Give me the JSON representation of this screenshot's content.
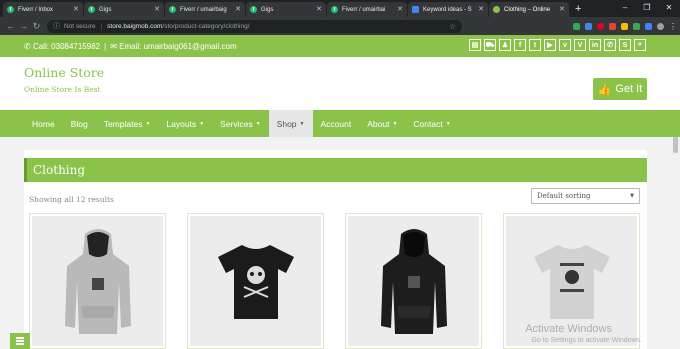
{
  "browser": {
    "tabs": [
      {
        "title": "Fiverr / Inbox",
        "icon": "fiverr-icon"
      },
      {
        "title": "Gigs",
        "icon": "fiverr-icon"
      },
      {
        "title": "Fiverr / umairbaig",
        "icon": "fiverr-icon"
      },
      {
        "title": "Gigs",
        "icon": "fiverr-icon"
      },
      {
        "title": "Fiverr / umairbai",
        "icon": "fiverr-icon"
      },
      {
        "title": "Keyword ideas - S",
        "icon": "google-ads-icon"
      },
      {
        "title": "Clothing – Online",
        "icon": "store-icon"
      }
    ],
    "security_label": "Not secure",
    "url_host": "store.baigmob.com",
    "url_path": "/sto/product-category/clothing/"
  },
  "topbar": {
    "phone": "Call: 03084715982",
    "email": "Email: umairbaig061@gmail.com",
    "social_icons": [
      "shop-icon",
      "cart-icon",
      "user-icon",
      "facebook-icon",
      "twitter-icon",
      "youtube-icon",
      "vk-icon",
      "vine-icon",
      "linkedin-icon",
      "whatsapp-icon",
      "skype-icon",
      "search-icon"
    ]
  },
  "header": {
    "site_title": "Online Store",
    "tagline": "Online Store Is Best",
    "cta_label": "Get It"
  },
  "nav": {
    "items": [
      {
        "label": "Home",
        "dropdown": false
      },
      {
        "label": "Blog",
        "dropdown": false
      },
      {
        "label": "Templates",
        "dropdown": true
      },
      {
        "label": "Layouts",
        "dropdown": true
      },
      {
        "label": "Services",
        "dropdown": true
      },
      {
        "label": "Shop",
        "dropdown": true,
        "active": true
      },
      {
        "label": "Account",
        "dropdown": false
      },
      {
        "label": "About",
        "dropdown": true
      },
      {
        "label": "Contact",
        "dropdown": true
      }
    ]
  },
  "main": {
    "page_title": "Clothing",
    "results_text": "Showing all 12 results",
    "sort_selected": "Default sorting",
    "products": [
      {
        "type": "hoodie",
        "color": "#b9b9b9"
      },
      {
        "type": "tshirt",
        "color": "#1b1b1b"
      },
      {
        "type": "hoodie",
        "color": "#1d1d1d"
      },
      {
        "type": "tshirt",
        "color": "#d2d2d2"
      }
    ]
  },
  "os": {
    "watermark_title": "Activate Windows",
    "watermark_sub": "Go to Settings to activate Windows."
  },
  "colors": {
    "accent": "#8bc34a"
  }
}
